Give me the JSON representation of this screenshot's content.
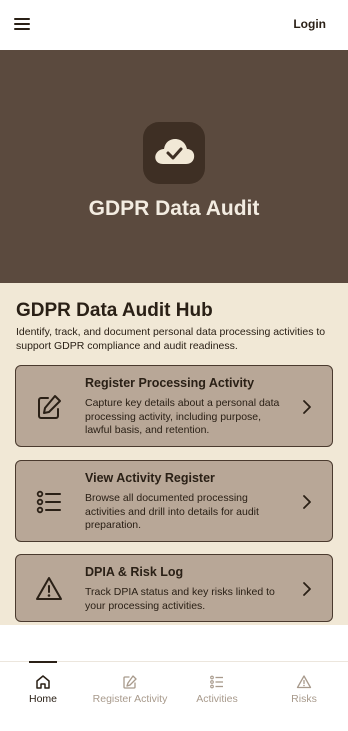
{
  "header": {
    "login_label": "Login"
  },
  "hero": {
    "title": "GDPR Data Audit"
  },
  "hub": {
    "title": "GDPR Data Audit Hub",
    "description": "Identify, track, and document personal data processing activities to support GDPR compliance and audit readiness."
  },
  "cards": [
    {
      "icon": "edit-icon",
      "title": "Register Processing Activity",
      "description": "Capture key details about a personal data processing activity, including purpose, lawful basis, and retention."
    },
    {
      "icon": "list-icon",
      "title": "View Activity Register",
      "description": "Browse all documented processing activities and drill into details for audit preparation."
    },
    {
      "icon": "warning-icon",
      "title": "DPIA & Risk Log",
      "description": "Track DPIA status and key risks linked to your processing activities."
    }
  ],
  "nav": [
    {
      "label": "Home",
      "icon": "home-icon",
      "active": true
    },
    {
      "label": "Register Activity",
      "icon": "edit-icon",
      "active": false
    },
    {
      "label": "Activities",
      "icon": "list-icon",
      "active": false
    },
    {
      "label": "Risks",
      "icon": "warning-icon",
      "active": false
    }
  ],
  "colors": {
    "hero_bg": "#5b4a3e",
    "content_bg": "#f1e8d6",
    "card_bg": "#b8a797",
    "text_dark": "#2a2016",
    "nav_inactive": "#a89a8c"
  }
}
